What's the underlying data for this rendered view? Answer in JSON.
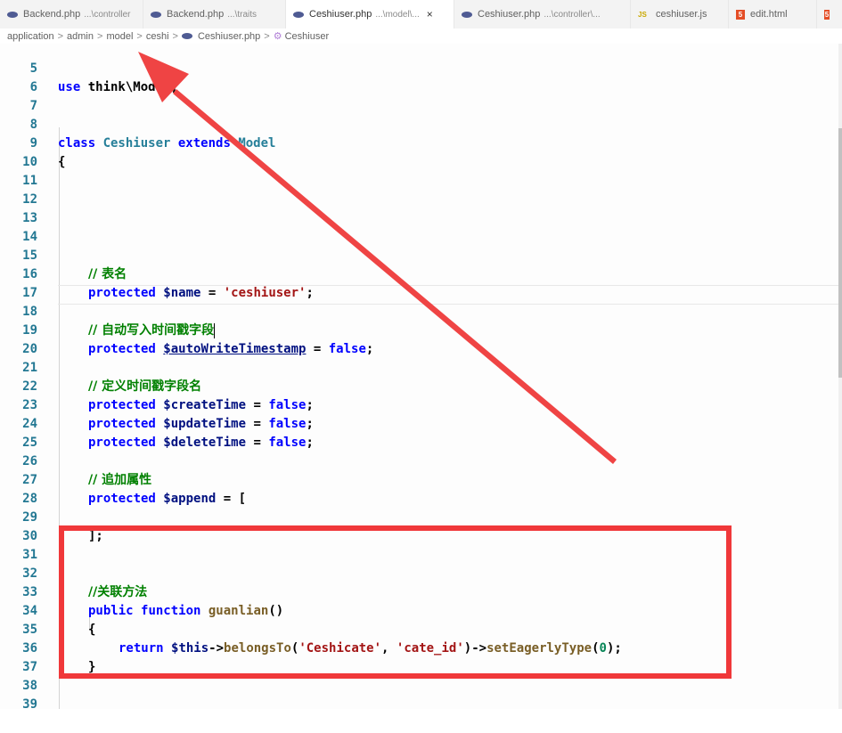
{
  "tabs": [
    {
      "label": "Backend.php",
      "hint": "...\\controller",
      "icon": "php-icon",
      "active": false
    },
    {
      "label": "Backend.php",
      "hint": "...\\traits",
      "icon": "php-icon",
      "active": false
    },
    {
      "label": "Ceshiuser.php",
      "hint": "...\\model\\...",
      "icon": "php-icon",
      "active": true,
      "close": "×"
    },
    {
      "label": "Ceshiuser.php",
      "hint": "...\\controller\\...",
      "icon": "php-icon",
      "active": false
    },
    {
      "label": "ceshiuser.js",
      "hint": "",
      "icon": "js-icon",
      "active": false
    },
    {
      "label": "edit.html",
      "hint": "",
      "icon": "html-icon",
      "active": false
    }
  ],
  "icons": {
    "php": "php-icon",
    "js": "JS",
    "html": "5"
  },
  "breadcrumb": {
    "items": [
      "application",
      "admin",
      "model",
      "ceshi",
      "Ceshiuser.php"
    ],
    "separator": ">",
    "symbol": "Ceshiuser"
  },
  "code": {
    "l5": {
      "num": "5",
      "a": "use ",
      "b": "think\\Model;"
    },
    "l6": {
      "num": "6"
    },
    "l7": {
      "num": "7"
    },
    "l8": {
      "num": "8",
      "a": "class ",
      "b": "Ceshiuser ",
      "c": "extends ",
      "d": "Model"
    },
    "l9": {
      "num": "9",
      "a": "{"
    },
    "l10": {
      "num": "10"
    },
    "l11": {
      "num": "11"
    },
    "l12": {
      "num": "12"
    },
    "l13": {
      "num": "13"
    },
    "l14": {
      "num": "14"
    },
    "l15": {
      "num": "15",
      "a": "// 表名"
    },
    "l16": {
      "num": "16",
      "a": "protected ",
      "b": "$name",
      "c": " = ",
      "d": "'ceshiuser'",
      "e": ";"
    },
    "l17": {
      "num": "17"
    },
    "l18": {
      "num": "18",
      "a": "// 自动写入时间戳字段"
    },
    "l19": {
      "num": "19",
      "a": "protected ",
      "b": "$autoWriteTimestamp",
      "c": " = ",
      "d": "false",
      "e": ";"
    },
    "l20": {
      "num": "20"
    },
    "l21": {
      "num": "21",
      "a": "// 定义时间戳字段名"
    },
    "l22": {
      "num": "22",
      "a": "protected ",
      "b": "$createTime",
      "c": " = ",
      "d": "false",
      "e": ";"
    },
    "l23": {
      "num": "23",
      "a": "protected ",
      "b": "$updateTime",
      "c": " = ",
      "d": "false",
      "e": ";"
    },
    "l24": {
      "num": "24",
      "a": "protected ",
      "b": "$deleteTime",
      "c": " = ",
      "d": "false",
      "e": ";"
    },
    "l25": {
      "num": "25"
    },
    "l26": {
      "num": "26",
      "a": "// 追加属性"
    },
    "l27": {
      "num": "27",
      "a": "protected ",
      "b": "$append",
      "c": " = ["
    },
    "l28": {
      "num": "28"
    },
    "l29": {
      "num": "29",
      "a": "];"
    },
    "l30": {
      "num": "30"
    },
    "l31": {
      "num": "31"
    },
    "l32": {
      "num": "32",
      "a": "//关联方法"
    },
    "l33": {
      "num": "33",
      "a": "public ",
      "b": "function ",
      "c": "guanlian",
      "d": "()"
    },
    "l34": {
      "num": "34",
      "a": "{"
    },
    "l35": {
      "num": "35",
      "a": "return ",
      "b": "$this",
      "c": "->",
      "d": "belongsTo",
      "e": "(",
      "f": "'Ceshicate'",
      "g": ", ",
      "h": "'cate_id'",
      "i": ")->",
      "j": "setEagerlyType",
      "k": "(",
      "l": "0",
      "m": ");"
    },
    "l36": {
      "num": "36",
      "a": "}"
    },
    "l37": {
      "num": "37"
    },
    "l38": {
      "num": "38"
    },
    "l39": {
      "num": "39"
    }
  },
  "annotation_colors": {
    "arrow": "#ef4444",
    "box": "#f0383a"
  }
}
